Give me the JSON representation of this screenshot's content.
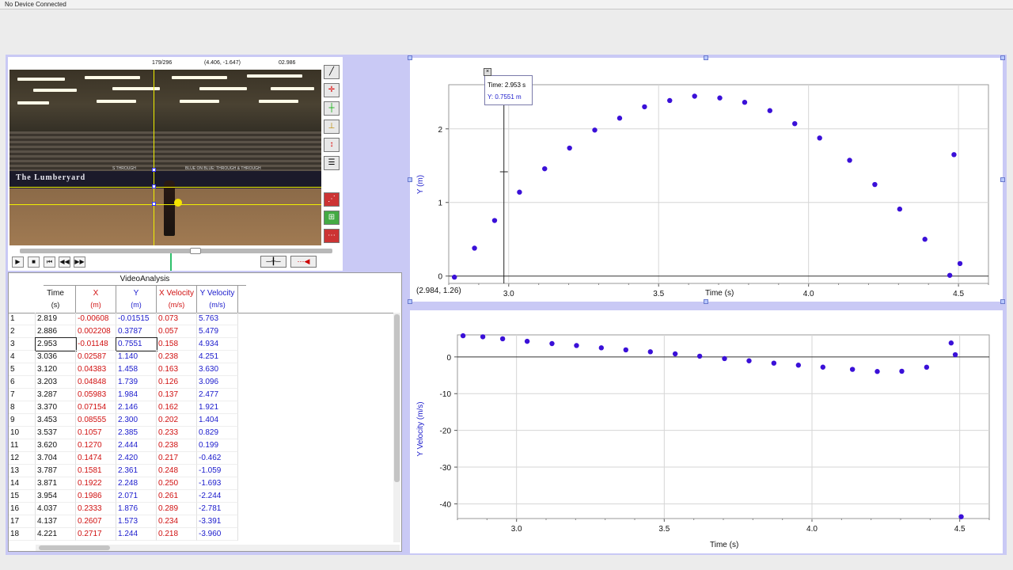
{
  "status_bar": {
    "device_status": "No Device Connected"
  },
  "video": {
    "frame_counter": "179/296",
    "coord_readout": "(4.406, -1.647)",
    "time_readout": "02.986",
    "banner_text": "The Lumberyard",
    "banner_slogan": "BLUE ON BLUE: THROUGH & THROUGH",
    "banner_left": "S THROUGH"
  },
  "controls": {
    "play": "▶",
    "stop": "■",
    "first": "⏮",
    "rewind": "◀◀",
    "forward": "▶▶"
  },
  "table": {
    "title": "VideoAnalysis",
    "columns": [
      {
        "name": "Time",
        "unit": "(s)"
      },
      {
        "name": "X",
        "unit": "(m)"
      },
      {
        "name": "Y",
        "unit": "(m)"
      },
      {
        "name": "X Velocity",
        "unit": "(m/s)"
      },
      {
        "name": "Y Velocity",
        "unit": "(m/s)"
      }
    ],
    "rows": [
      [
        "1",
        "2.819",
        "-0.00608",
        "-0.01515",
        "0.073",
        "5.763"
      ],
      [
        "2",
        "2.886",
        "0.002208",
        "0.3787",
        "0.057",
        "5.479"
      ],
      [
        "3",
        "2.953",
        "-0.01148",
        "0.7551",
        "0.158",
        "4.934"
      ],
      [
        "4",
        "3.036",
        "0.02587",
        "1.140",
        "0.238",
        "4.251"
      ],
      [
        "5",
        "3.120",
        "0.04383",
        "1.458",
        "0.163",
        "3.630"
      ],
      [
        "6",
        "3.203",
        "0.04848",
        "1.739",
        "0.126",
        "3.096"
      ],
      [
        "7",
        "3.287",
        "0.05983",
        "1.984",
        "0.137",
        "2.477"
      ],
      [
        "8",
        "3.370",
        "0.07154",
        "2.146",
        "0.162",
        "1.921"
      ],
      [
        "9",
        "3.453",
        "0.08555",
        "2.300",
        "0.202",
        "1.404"
      ],
      [
        "10",
        "3.537",
        "0.1057",
        "2.385",
        "0.233",
        "0.829"
      ],
      [
        "11",
        "3.620",
        "0.1270",
        "2.444",
        "0.238",
        "0.199"
      ],
      [
        "12",
        "3.704",
        "0.1474",
        "2.420",
        "0.217",
        "-0.462"
      ],
      [
        "13",
        "3.787",
        "0.1581",
        "2.361",
        "0.248",
        "-1.059"
      ],
      [
        "14",
        "3.871",
        "0.1922",
        "2.248",
        "0.250",
        "-1.693"
      ],
      [
        "15",
        "3.954",
        "0.1986",
        "2.071",
        "0.261",
        "-2.244"
      ],
      [
        "16",
        "4.037",
        "0.2333",
        "1.876",
        "0.289",
        "-2.781"
      ],
      [
        "17",
        "4.137",
        "0.2607",
        "1.573",
        "0.234",
        "-3.391"
      ],
      [
        "18",
        "4.221",
        "0.2717",
        "1.244",
        "0.218",
        "-3.960"
      ]
    ]
  },
  "graph1": {
    "tooltip_time": "Time: 2.953 s",
    "tooltip_y": "Y: 0.7551 m",
    "coord_readout": "(2.984, 1.26)",
    "xlabel": "Time (s)",
    "ylabel": "Y (m)"
  },
  "graph2": {
    "xlabel": "Time (s)",
    "ylabel": "Y Velocity (m/s)"
  },
  "colors": {
    "point": "#3a10d8",
    "x_col": "#d01010",
    "y_col": "#1a1acc",
    "frame": "#c9c9f5"
  },
  "chart_data": [
    {
      "type": "scatter",
      "title": "",
      "xlabel": "Time (s)",
      "ylabel": "Y (m)",
      "xlim": [
        2.8,
        4.6
      ],
      "ylim": [
        -0.1,
        2.6
      ],
      "xticks": [
        3.0,
        3.5,
        4.0,
        4.5
      ],
      "yticks": [
        0,
        1,
        2
      ],
      "grid": true,
      "x": [
        2.819,
        2.886,
        2.953,
        3.036,
        3.12,
        3.203,
        3.287,
        3.37,
        3.453,
        3.537,
        3.62,
        3.704,
        3.787,
        3.871,
        3.954,
        4.037,
        4.137,
        4.221,
        4.304,
        4.388,
        4.471,
        4.485,
        4.505
      ],
      "y": [
        -0.015,
        0.379,
        0.755,
        1.14,
        1.458,
        1.739,
        1.984,
        2.146,
        2.3,
        2.385,
        2.444,
        2.42,
        2.361,
        2.248,
        2.071,
        1.876,
        1.573,
        1.244,
        0.91,
        0.5,
        0.01,
        1.65,
        0.17
      ]
    },
    {
      "type": "scatter",
      "title": "",
      "xlabel": "Time (s)",
      "ylabel": "Y Velocity (m/s)",
      "xlim": [
        2.8,
        4.6
      ],
      "ylim": [
        -44,
        6
      ],
      "xticks": [
        3.0,
        3.5,
        4.0,
        4.5
      ],
      "yticks": [
        0,
        -10,
        -20,
        -30,
        -40
      ],
      "grid": true,
      "x": [
        2.819,
        2.886,
        2.953,
        3.036,
        3.12,
        3.203,
        3.287,
        3.37,
        3.453,
        3.537,
        3.62,
        3.704,
        3.787,
        3.871,
        3.954,
        4.037,
        4.137,
        4.221,
        4.304,
        4.388,
        4.471,
        4.485,
        4.505
      ],
      "y": [
        5.763,
        5.479,
        4.934,
        4.251,
        3.63,
        3.096,
        2.477,
        1.921,
        1.404,
        0.829,
        0.199,
        -0.462,
        -1.059,
        -1.693,
        -2.244,
        -2.781,
        -3.391,
        -3.96,
        -3.9,
        -2.8,
        3.8,
        0.6,
        -43.5
      ]
    }
  ]
}
